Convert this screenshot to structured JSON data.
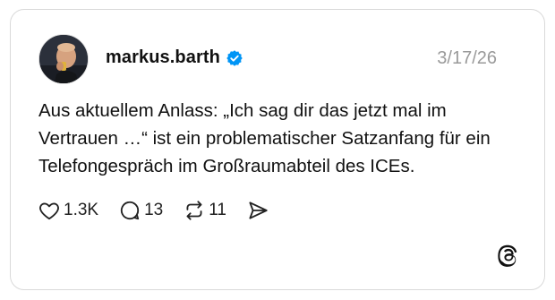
{
  "post": {
    "username": "markus.barth",
    "verified": true,
    "date": "3/17/26",
    "text": "Aus aktuellem Anlass: „Ich sag dir das jetzt mal im Vertrauen …“ ist ein problematischer Satzanfang für ein Telefongespräch im Großraumabteil des ICEs."
  },
  "actions": {
    "likes": "1.3K",
    "replies": "13",
    "reposts": "11"
  },
  "icons": {
    "verified": "verified-badge-icon",
    "like": "heart-icon",
    "reply": "speech-bubble-icon",
    "repost": "repost-arrows-icon",
    "share": "send-icon",
    "logo": "threads-logo-icon"
  },
  "colors": {
    "verified": "#0095f6",
    "date": "#9a9a9a",
    "border": "#d9d9d9"
  }
}
